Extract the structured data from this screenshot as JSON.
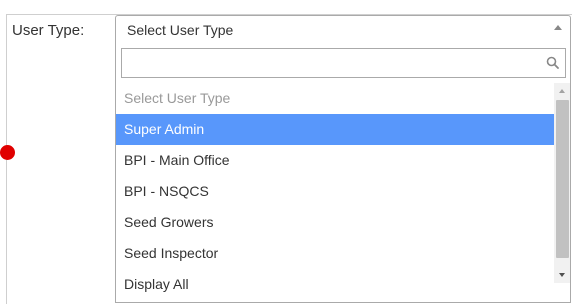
{
  "form": {
    "user_type_label": "User Type:"
  },
  "select": {
    "selected_value": "Select User Type",
    "search": {
      "value": "",
      "placeholder": ""
    },
    "options": [
      {
        "label": "Select User Type",
        "state": "placeholder"
      },
      {
        "label": "Super Admin",
        "state": "highlighted"
      },
      {
        "label": "BPI - Main Office",
        "state": "normal"
      },
      {
        "label": "BPI - NSQCS",
        "state": "normal"
      },
      {
        "label": "Seed Growers",
        "state": "normal"
      },
      {
        "label": "Seed Inspector",
        "state": "normal"
      },
      {
        "label": "Display All",
        "state": "normal"
      }
    ]
  },
  "colors": {
    "highlight": "#5897fb",
    "marker": "#e00000"
  },
  "icons": {
    "select_arrow": "chevron-up-icon",
    "search": "search-icon"
  }
}
